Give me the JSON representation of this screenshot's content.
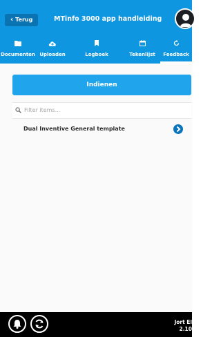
{
  "header": {
    "back_label": "Terug",
    "title": "MTinfo 3000 app handleiding"
  },
  "tabs": [
    {
      "label": "Documenten",
      "icon": "folder-icon"
    },
    {
      "label": "Uploaden",
      "icon": "cloud-upload-icon"
    },
    {
      "label": "Logboek",
      "icon": "bookmark-icon"
    },
    {
      "label": "Tekenlijst",
      "icon": "calendar-icon"
    },
    {
      "label": "Feedback",
      "icon": "refresh-icon",
      "active": true
    }
  ],
  "main": {
    "submit_label": "Indienen",
    "filter_placeholder": "Filter items...",
    "items": [
      {
        "label": "Dual Inventive General template"
      }
    ]
  },
  "footer": {
    "user_name": "Jort El",
    "version": "2.10"
  },
  "colors": {
    "header_bg": "#0e96e0",
    "button_bg": "#20a4ec",
    "arrow_bg": "#0a74bd",
    "footer_bg": "#000000"
  }
}
